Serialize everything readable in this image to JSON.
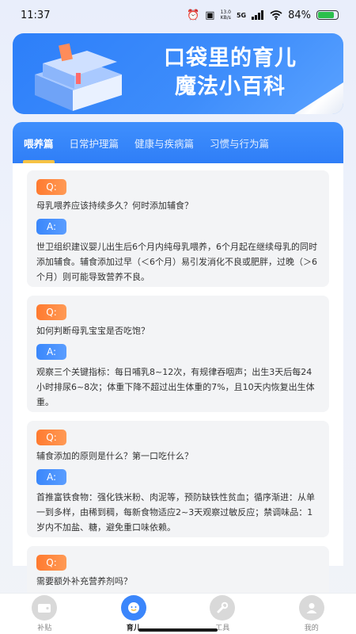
{
  "status_bar": {
    "time": "11:37",
    "net_speed_value": "13.0",
    "net_speed_unit": "KB/s",
    "network": "5G",
    "battery": "84%",
    "battery_level": 0.84
  },
  "banner": {
    "title_line1": "口袋里的育儿",
    "title_line2": "魔法小百科"
  },
  "tabs": [
    {
      "label": "喂养篇",
      "active": true
    },
    {
      "label": "日常护理篇",
      "active": false
    },
    {
      "label": "健康与疾病篇",
      "active": false
    },
    {
      "label": "习惯与行为篇",
      "active": false
    }
  ],
  "badges": {
    "q": "Q:",
    "a": "A:"
  },
  "qa": [
    {
      "question": "母乳喂养应该持续多久？何时添加辅食？",
      "answer": "世卫组织建议婴儿出生后6个月内纯母乳喂养，6个月起在继续母乳的同时添加辅食。辅食添加过早（＜6个月）易引发消化不良或肥胖，过晚（＞6个月）则可能导致营养不良。"
    },
    {
      "question": "如何判断母乳宝宝是否吃饱？",
      "answer": "观察三个关键指标：每日哺乳8~12次，有规律吞咽声；出生3天后每24小时排尿6~8次；体重下降不超过出生体重的7%，且10天内恢复出生体重。"
    },
    {
      "question": "辅食添加的原则是什么？第一口吃什么？",
      "answer": "首推富铁食物：强化铁米粉、肉泥等，预防缺铁性贫血；循序渐进：从单一到多样，由稀到稠，每新食物适应2~3天观察过敏反应；禁调味品：1岁内不加盐、糖，避免重口味依赖。"
    },
    {
      "question": "需要额外补充营养剂吗？",
      "answer": ""
    }
  ],
  "bottom_nav": [
    {
      "label": "补贴",
      "icon": "wallet-icon",
      "active": false
    },
    {
      "label": "育儿",
      "icon": "baby-icon",
      "active": true
    },
    {
      "label": "工具",
      "icon": "wrench-icon",
      "active": false
    },
    {
      "label": "我的",
      "icon": "user-icon",
      "active": false
    }
  ],
  "colors": {
    "accent": "#3b86fb",
    "q_badge": "#ff8a3d",
    "tab_indicator": "#f6c244"
  }
}
